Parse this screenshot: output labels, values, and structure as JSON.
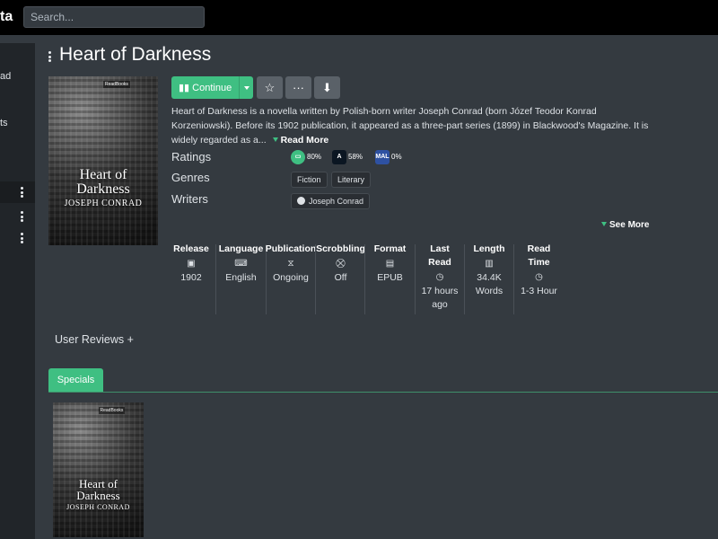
{
  "nav": {
    "brand": "ta",
    "search_placeholder": "Search..."
  },
  "sidebar": {
    "fragments": [
      "ad",
      "ts"
    ]
  },
  "series": {
    "title": "Heart of Darkness",
    "cover": {
      "publisher": "ReadBooks",
      "title_line1": "Heart of",
      "title_line2": "Darkness",
      "author": "JOSEPH CONRAD"
    },
    "actions": {
      "continue_label": "Continue",
      "star_icon": "☆",
      "more_icon": "···",
      "download_icon": "⬇"
    },
    "summary": "Heart of Darkness is a novella written by Polish-born writer Joseph Conrad (born Józef Teodor Konrad Korzeniowski). Before its 1902 publication, it appeared as a three-part series (1899) in Blackwood's Magazine. It is widely regarded as a...",
    "read_more": "Read More",
    "labels": {
      "ratings": "Ratings",
      "genres": "Genres",
      "writers": "Writers"
    },
    "ratings": [
      {
        "source": "kavita",
        "value": "80%",
        "color": "#3fbf82"
      },
      {
        "source": "anilist",
        "value": "58%",
        "color": "#0b1622"
      },
      {
        "source": "mal",
        "value": "0%",
        "color": "#2e51a2"
      }
    ],
    "genres": [
      "Fiction",
      "Literary"
    ],
    "writers": [
      "Joseph Conrad"
    ],
    "see_more": "See More",
    "stats": [
      {
        "header_1": "Release",
        "header_2": "",
        "icon": "calendar-icon",
        "glyph": "▣",
        "value_1": "1902",
        "value_2": ""
      },
      {
        "header_1": "Language",
        "header_2": "",
        "icon": "language-icon",
        "glyph": "⌨",
        "value_1": "English",
        "value_2": ""
      },
      {
        "header_1": "Publication",
        "header_2": "",
        "icon": "hourglass-icon",
        "glyph": "⧖",
        "value_1": "Ongoing",
        "value_2": ""
      },
      {
        "header_1": "Scrobbling",
        "header_2": "",
        "icon": "scrobble-icon",
        "glyph": "⛒",
        "value_1": "Off",
        "value_2": ""
      },
      {
        "header_1": "Format",
        "header_2": "",
        "icon": "book-icon",
        "glyph": "▤",
        "value_1": "EPUB",
        "value_2": ""
      },
      {
        "header_1": "Last",
        "header_2": "Read",
        "icon": "clock-icon",
        "glyph": "◷",
        "value_1": "17 hours",
        "value_2": "ago"
      },
      {
        "header_1": "Length",
        "header_2": "",
        "icon": "open-book-icon",
        "glyph": "▥",
        "value_1": "34.4K",
        "value_2": "Words"
      },
      {
        "header_1": "Read",
        "header_2": "Time",
        "icon": "clock-icon",
        "glyph": "◷",
        "value_1": "1-3 Hour",
        "value_2": ""
      }
    ],
    "reviews_label": "User Reviews +",
    "tab_specials": "Specials",
    "accent": "#3fbf82"
  }
}
